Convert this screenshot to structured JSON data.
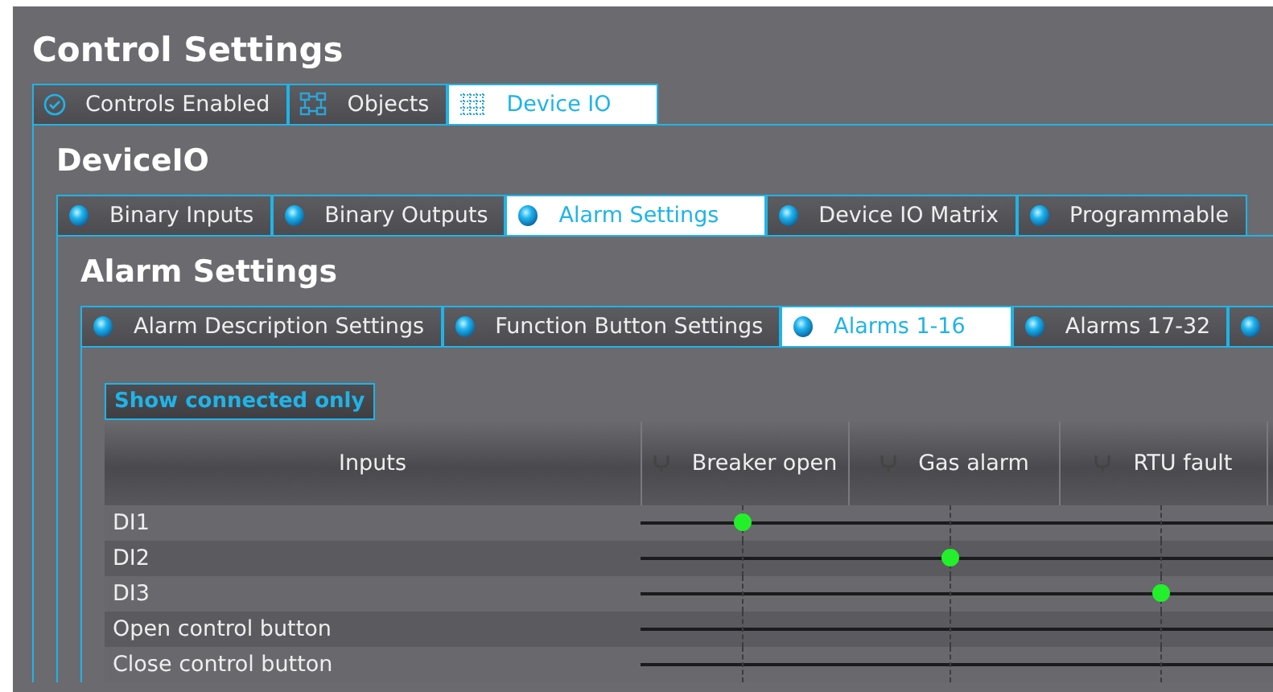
{
  "title": "Control Settings",
  "tabs": [
    {
      "label": "Controls Enabled",
      "kind": "check",
      "selected": false
    },
    {
      "label": "Objects",
      "kind": "objects",
      "selected": false
    },
    {
      "label": "Device IO",
      "kind": "grid",
      "selected": true
    }
  ],
  "device_io": {
    "title": "DeviceIO",
    "tabs": [
      {
        "label": "Binary Inputs",
        "kind": "sphere",
        "selected": false
      },
      {
        "label": "Binary Outputs",
        "kind": "sphere",
        "selected": false
      },
      {
        "label": "Alarm Settings",
        "kind": "sphere",
        "selected": true
      },
      {
        "label": "Device IO Matrix",
        "kind": "sphere",
        "selected": false
      },
      {
        "label": "Programmable",
        "kind": "sphere",
        "selected": false
      }
    ]
  },
  "alarm_settings": {
    "title": "Alarm Settings",
    "tabs": [
      {
        "label": "Alarm Description Settings",
        "kind": "sphere",
        "selected": false
      },
      {
        "label": "Function Button Settings",
        "kind": "sphere",
        "selected": false
      },
      {
        "label": "Alarms 1-16",
        "kind": "sphere",
        "selected": true
      },
      {
        "label": "Alarms 17-32",
        "kind": "sphere",
        "selected": false
      },
      {
        "kind": "sphere",
        "selected": false
      }
    ],
    "show_connected_button": "Show connected only",
    "table": {
      "first_column": "Inputs",
      "columns": [
        "Breaker open",
        "Gas alarm",
        "RTU fault"
      ],
      "rows": [
        {
          "name": "DI1",
          "connected": [
            true,
            false,
            false
          ]
        },
        {
          "name": "DI2",
          "connected": [
            false,
            true,
            false
          ]
        },
        {
          "name": "DI3",
          "connected": [
            false,
            false,
            true
          ]
        },
        {
          "name": "Open control button",
          "connected": [
            false,
            false,
            false
          ]
        },
        {
          "name": "Close control button",
          "connected": [
            false,
            false,
            false
          ]
        }
      ]
    }
  }
}
